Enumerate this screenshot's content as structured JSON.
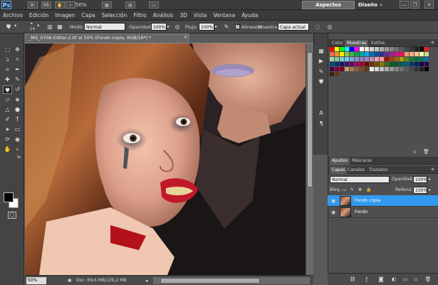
{
  "appbar": {
    "logo": "Ps",
    "icons": [
      "Br",
      "Mb"
    ],
    "zoom": "50%",
    "workspace_active": "Aspectos esenciales",
    "workspace_other": "Diseño",
    "workspace_more": "»",
    "window_buttons": [
      "—",
      "❐",
      "✕"
    ]
  },
  "menubar": [
    "Archivo",
    "Edición",
    "Imagen",
    "Capa",
    "Selección",
    "Filtro",
    "Análisis",
    "3D",
    "Vista",
    "Ventana",
    "Ayuda"
  ],
  "options": {
    "brush_size": "14",
    "modo_label": "Modo:",
    "modo_value": "Normal",
    "opacidad_label": "Opacidad:",
    "opacidad_value": "100%",
    "flujo_label": "Flujo:",
    "flujo_value": "100%",
    "alineado_label": "Alineado",
    "muestra_label": "Muestra:",
    "muestra_value": "Capa actual"
  },
  "document": {
    "tab_title": "_MG_0706-Editar-2.tif al 50% (Fondo copia, RGB/16*) *",
    "zoom": "50%",
    "doc_info": "Doc: 69,6 MB/139,2 MB"
  },
  "swatches_panel": {
    "tabs": [
      "Color",
      "Muestras",
      "Estilos"
    ],
    "active_tab": 1
  },
  "layers_panel": {
    "upper_tabs": [
      "Ajustes",
      "Máscaras"
    ],
    "tabs": [
      "Capas",
      "Canales",
      "Trazados"
    ],
    "active_tab": 0,
    "blend_mode": "Normal",
    "opacidad_label": "Opacidad:",
    "opacidad_value": "100%",
    "bloq_label": "Bloq.:",
    "relleno_label": "Relleno:",
    "relleno_value": "100%",
    "layers": [
      {
        "name": "Fondo copia",
        "selected": true
      },
      {
        "name": "Fondo",
        "selected": false
      }
    ]
  },
  "colors": {
    "selection": "#3399ee",
    "foreground": "#000000",
    "background": "#ffffff"
  }
}
